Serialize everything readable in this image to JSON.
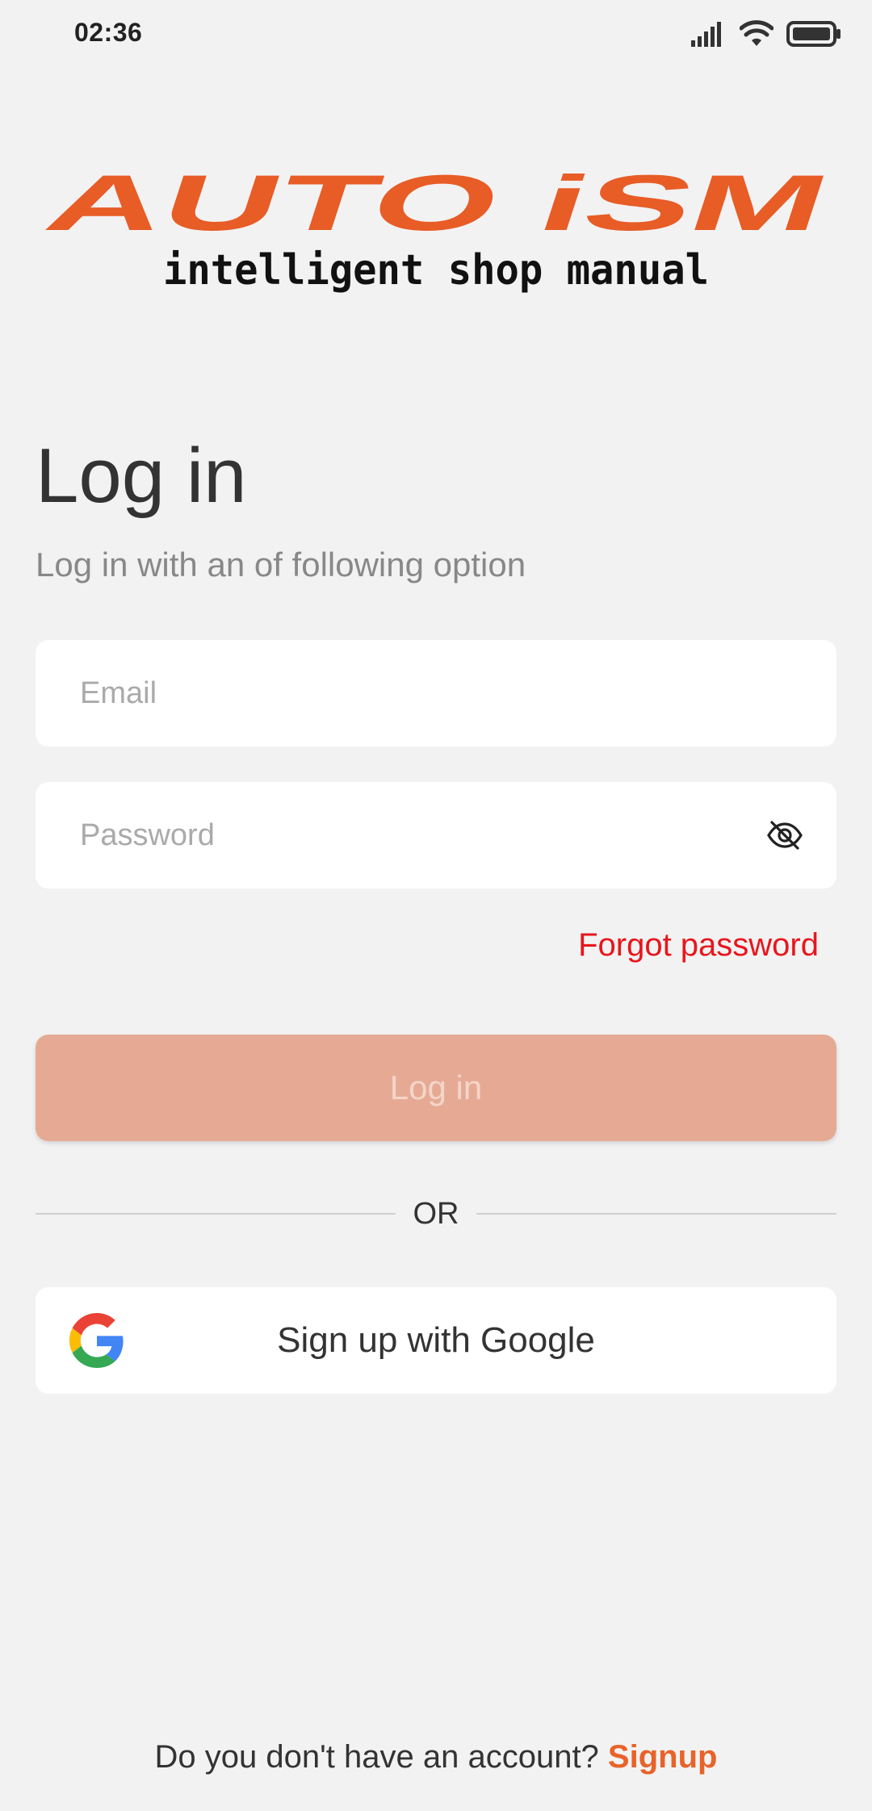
{
  "status_bar": {
    "time": "02:36",
    "icons": [
      "signal-icon",
      "wifi-icon",
      "battery-icon"
    ]
  },
  "logo": {
    "brand": "AUTO iSM",
    "tagline": "intelligent shop manual",
    "brand_color": "#e85c26"
  },
  "header": {
    "title": "Log in",
    "subtitle": "Log in with an of following option"
  },
  "form": {
    "email_placeholder": "Email",
    "email_value": "",
    "password_placeholder": "Password",
    "password_value": "",
    "password_toggle_icon": "eye-off-icon",
    "forgot_password_label": "Forgot password",
    "login_button_label": "Log in",
    "login_button_enabled": false
  },
  "divider": {
    "label": "OR"
  },
  "social": {
    "google_label": "Sign up with Google",
    "google_icon": "google-icon"
  },
  "footer": {
    "prompt": "Do you don't have an account? ",
    "signup_label": "Signup"
  },
  "colors": {
    "background": "#f2f2f2",
    "accent": "#e8632a",
    "forgot_link": "#e8161c",
    "login_disabled_bg": "#e6aa94",
    "login_disabled_text": "#f4d5c9"
  }
}
